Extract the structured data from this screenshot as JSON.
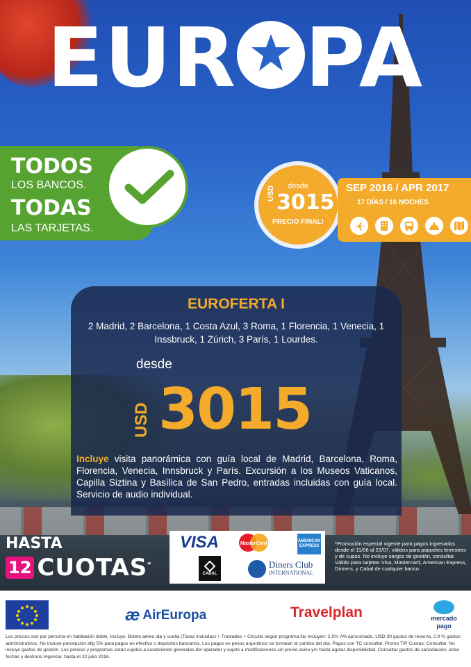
{
  "title": {
    "left": "EUR",
    "right": "PA"
  },
  "banks": {
    "line1": "TODOS",
    "line2": "LOS BANCOS.",
    "line3": "TODAS",
    "line4": "LAS TARJETAS."
  },
  "price_badge": {
    "desde": "desde",
    "currency": "USD",
    "amount": "3015",
    "final": "PRECIO FINAL!"
  },
  "dates": {
    "range": "SEP 2016 / APR 2017",
    "duration": "17 DÍAS / 16 NOCHES",
    "icons": [
      "airplane-icon",
      "hotel-icon",
      "bus-icon",
      "service-bell-icon",
      "map-icon"
    ]
  },
  "offer": {
    "name": "EUROFERTA I",
    "route": "2 Madrid, 2 Barcelona, 1 Costa Azul, 3 Roma, 1 Florencia, 1 Venecia, 1 Inssbruck, 1 Zúrich, 3 París, 1 Lourdes.",
    "desde": "desde",
    "currency": "USD",
    "amount": "3015",
    "includes_label": "Incluye",
    "includes_text": " visita panorámica con guía local de Madrid, Barcelona, Roma, Florencia, Venecia, Innsbruck y París. Excursión a los Museos Vaticanos, Capilla Siztina y Basílica de San Pedro, entradas incluidas con guía local. Servicio de audio individual."
  },
  "cuotas": {
    "hasta": "HASTA",
    "number": "12",
    "label": "CUOTAS",
    "mark": "*"
  },
  "cards": {
    "visa": "VISA",
    "mastercard": "MasterCard",
    "amex": "AMERICAN EXPRESS",
    "cabal": "CABAL",
    "diners": "Diners Club",
    "diners_sub": "INTERNATIONAL"
  },
  "promo": "*Promoción especial vigente para pagos ingresados desde el 11/06 al 22/07, válidos para paquetes terrestres y de cupos. No incluye cargos de gestión, consultar. Válido para tarjetas Visa, Mastercard, American Express, Dinners, y Cabal de cualquier banco.",
  "footer": {
    "aireuropa": "AirEuropa",
    "aireuropa_mark": "æ",
    "travelplan": "Travelplan",
    "mercadopago_1": "mercado",
    "mercadopago_2": "pago"
  },
  "fine_print": "Los precios son por persona en habitación doble. Incluye: Boleto aéreo ida y vuelta (Tasas incluidas) + Traslados + Circuito según programa.No incluyen: 2.5% IVA aproximado, USD 30 gastos de reserva, 2.9 % gastos administrativos. No incluye percepción afip 5% para pagos en efectivo o depósitos bancarios. Los pagos en pesos argentinos se tomaran al cambio del día. Pagos con TC consultar. Promo TIP Cuotas: Consultar. No incluye gastos de gestión. Los precios y programas están sujetos a condiciones generales del operador y sujeto a modificaciones sin previo aviso y/o hasta agotar disponibilidad. Consultar gastos de cancelación, otras fechas y destinos.Vigencia: hasta el 22 julio 2016.",
  "colors": {
    "orange": "#f4ab2b",
    "green": "#56a331",
    "navy": "#19284e",
    "magenta": "#e6127e",
    "sky": "#2a64c9"
  }
}
